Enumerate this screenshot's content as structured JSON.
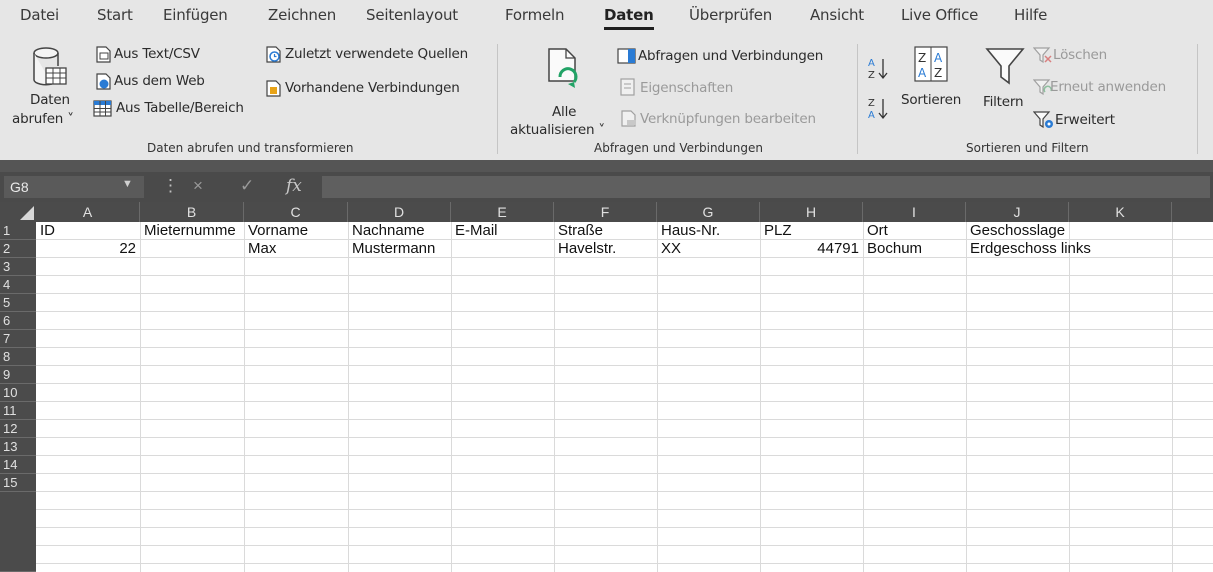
{
  "menu": {
    "tabs": [
      "Datei",
      "Start",
      "Einfügen",
      "Zeichnen",
      "Seitenlayout",
      "Formeln",
      "Daten",
      "Überprüfen",
      "Ansicht",
      "Live Office",
      "Hilfe"
    ],
    "active": "Daten"
  },
  "ribbon": {
    "get_data": {
      "label_line1": "Daten",
      "label_line2": "abrufen ˅",
      "from_text_csv": "Aus Text/CSV",
      "from_web": "Aus dem Web",
      "from_table": "Aus Tabelle/Bereich",
      "recent_sources": "Zuletzt verwendete Quellen",
      "existing_connections": "Vorhandene Verbindungen",
      "group_label": "Daten abrufen und transformieren"
    },
    "queries": {
      "refresh_line1": "Alle",
      "refresh_line2": "aktualisieren ˅",
      "queries_connections": "Abfragen und Verbindungen",
      "properties": "Eigenschaften",
      "edit_links": "Verknüpfungen bearbeiten",
      "group_label": "Abfragen und Verbindungen"
    },
    "sort_filter": {
      "sort": "Sortieren",
      "filter": "Filtern",
      "clear": "Löschen",
      "reapply": "Erneut anwenden",
      "advanced": "Erweitert",
      "group_label": "Sortieren und Filtern"
    }
  },
  "formula_bar": {
    "name_box": "G8",
    "fx": "fx",
    "cancel": "×",
    "confirm": "✓",
    "content": ""
  },
  "sheet": {
    "columns": [
      "A",
      "B",
      "C",
      "D",
      "E",
      "F",
      "G",
      "H",
      "I",
      "J",
      "K"
    ],
    "rows": [
      "1",
      "2",
      "3",
      "4",
      "5",
      "6",
      "7",
      "8",
      "9",
      "10",
      "11",
      "12",
      "13",
      "14",
      "15"
    ],
    "header_row": [
      "ID",
      "Mieternumme",
      "Vorname",
      "Nachname",
      "E-Mail",
      "Straße",
      "Haus-Nr.",
      "PLZ",
      "Ort",
      "Geschosslage",
      ""
    ],
    "data_row": [
      "22",
      "",
      "Max",
      "Mustermann",
      "",
      "Havelstr.",
      "XX",
      "44791",
      "Bochum",
      "Erdgeschoss links",
      ""
    ]
  }
}
